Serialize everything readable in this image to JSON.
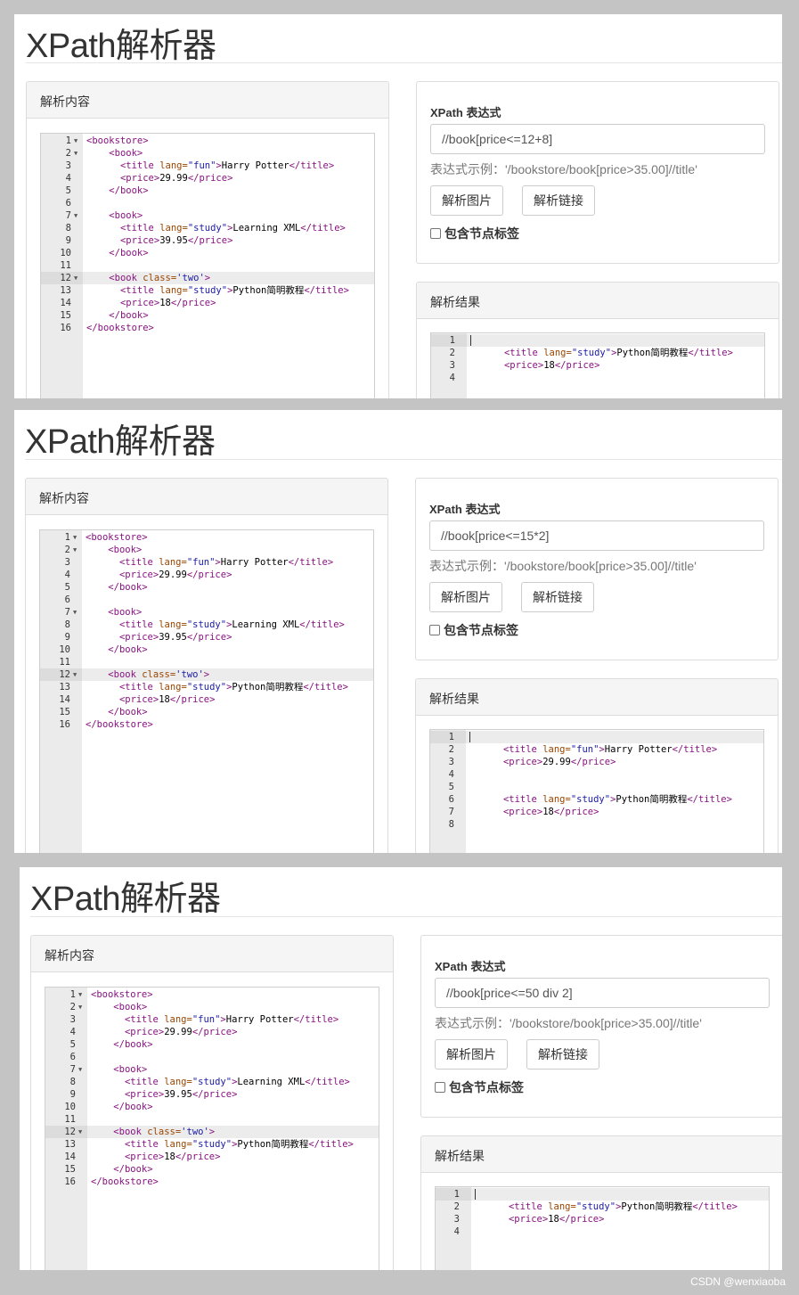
{
  "app_title": "XPath解析器",
  "content_panel_title": "解析内容",
  "xpath_label": "XPath 表达式",
  "example_label": "表达式示例：",
  "example_expr": "'/bookstore/book[price>35.00]//title'",
  "parse_image_button": "解析图片",
  "parse_link_button": "解析链接",
  "include_tags_label": "包含节点标签",
  "result_panel_title": "解析结果",
  "source_code": [
    [
      {
        "t": "tag",
        "s": "<bookstore>"
      }
    ],
    [
      {
        "t": "txt",
        "s": "    "
      },
      {
        "t": "tag",
        "s": "<book>"
      }
    ],
    [
      {
        "t": "txt",
        "s": "      "
      },
      {
        "t": "tag",
        "s": "<title "
      },
      {
        "t": "attr",
        "s": "lang="
      },
      {
        "t": "val",
        "s": "\"fun\""
      },
      {
        "t": "tag",
        "s": ">"
      },
      {
        "t": "txt",
        "s": "Harry Potter"
      },
      {
        "t": "tag",
        "s": "</title>"
      }
    ],
    [
      {
        "t": "txt",
        "s": "      "
      },
      {
        "t": "tag",
        "s": "<price>"
      },
      {
        "t": "txt",
        "s": "29.99"
      },
      {
        "t": "tag",
        "s": "</price>"
      }
    ],
    [
      {
        "t": "txt",
        "s": "    "
      },
      {
        "t": "tag",
        "s": "</book>"
      }
    ],
    [],
    [
      {
        "t": "txt",
        "s": "    "
      },
      {
        "t": "tag",
        "s": "<book>"
      }
    ],
    [
      {
        "t": "txt",
        "s": "      "
      },
      {
        "t": "tag",
        "s": "<title "
      },
      {
        "t": "attr",
        "s": "lang="
      },
      {
        "t": "val",
        "s": "\"study\""
      },
      {
        "t": "tag",
        "s": ">"
      },
      {
        "t": "txt",
        "s": "Learning XML"
      },
      {
        "t": "tag",
        "s": "</title>"
      }
    ],
    [
      {
        "t": "txt",
        "s": "      "
      },
      {
        "t": "tag",
        "s": "<price>"
      },
      {
        "t": "txt",
        "s": "39.95"
      },
      {
        "t": "tag",
        "s": "</price>"
      }
    ],
    [
      {
        "t": "txt",
        "s": "    "
      },
      {
        "t": "tag",
        "s": "</book>"
      }
    ],
    [],
    [
      {
        "t": "txt",
        "s": "    "
      },
      {
        "t": "tag",
        "s": "<book "
      },
      {
        "t": "attr",
        "s": "class="
      },
      {
        "t": "val",
        "s": "'two'"
      },
      {
        "t": "tag",
        "s": ">"
      }
    ],
    [
      {
        "t": "txt",
        "s": "      "
      },
      {
        "t": "tag",
        "s": "<title "
      },
      {
        "t": "attr",
        "s": "lang="
      },
      {
        "t": "val",
        "s": "\"study\""
      },
      {
        "t": "tag",
        "s": ">"
      },
      {
        "t": "txt",
        "s": "Python简明教程"
      },
      {
        "t": "tag",
        "s": "</title>"
      }
    ],
    [
      {
        "t": "txt",
        "s": "      "
      },
      {
        "t": "tag",
        "s": "<price>"
      },
      {
        "t": "txt",
        "s": "18"
      },
      {
        "t": "tag",
        "s": "</price>"
      }
    ],
    [
      {
        "t": "txt",
        "s": "    "
      },
      {
        "t": "tag",
        "s": "</book>"
      }
    ],
    [
      {
        "t": "tag",
        "s": "</bookstore>"
      }
    ]
  ],
  "fold_lines": [
    1,
    2,
    7,
    12
  ],
  "active_line": 12,
  "screens": [
    {
      "xpath": "//book[price<=12+8]",
      "result": [
        [],
        [
          {
            "t": "txt",
            "s": "      "
          },
          {
            "t": "tag",
            "s": "<title "
          },
          {
            "t": "attr",
            "s": "lang="
          },
          {
            "t": "val",
            "s": "\"study\""
          },
          {
            "t": "tag",
            "s": ">"
          },
          {
            "t": "txt",
            "s": "Python简明教程"
          },
          {
            "t": "tag",
            "s": "</title>"
          }
        ],
        [
          {
            "t": "txt",
            "s": "      "
          },
          {
            "t": "tag",
            "s": "<price>"
          },
          {
            "t": "txt",
            "s": "18"
          },
          {
            "t": "tag",
            "s": "</price>"
          }
        ],
        []
      ]
    },
    {
      "xpath": "//book[price<=15*2]",
      "result": [
        [],
        [
          {
            "t": "txt",
            "s": "      "
          },
          {
            "t": "tag",
            "s": "<title "
          },
          {
            "t": "attr",
            "s": "lang="
          },
          {
            "t": "val",
            "s": "\"fun\""
          },
          {
            "t": "tag",
            "s": ">"
          },
          {
            "t": "txt",
            "s": "Harry Potter"
          },
          {
            "t": "tag",
            "s": "</title>"
          }
        ],
        [
          {
            "t": "txt",
            "s": "      "
          },
          {
            "t": "tag",
            "s": "<price>"
          },
          {
            "t": "txt",
            "s": "29.99"
          },
          {
            "t": "tag",
            "s": "</price>"
          }
        ],
        [],
        [],
        [
          {
            "t": "txt",
            "s": "      "
          },
          {
            "t": "tag",
            "s": "<title "
          },
          {
            "t": "attr",
            "s": "lang="
          },
          {
            "t": "val",
            "s": "\"study\""
          },
          {
            "t": "tag",
            "s": ">"
          },
          {
            "t": "txt",
            "s": "Python简明教程"
          },
          {
            "t": "tag",
            "s": "</title>"
          }
        ],
        [
          {
            "t": "txt",
            "s": "      "
          },
          {
            "t": "tag",
            "s": "<price>"
          },
          {
            "t": "txt",
            "s": "18"
          },
          {
            "t": "tag",
            "s": "</price>"
          }
        ],
        []
      ]
    },
    {
      "xpath": "//book[price<=50 div 2]",
      "result": [
        [],
        [
          {
            "t": "txt",
            "s": "      "
          },
          {
            "t": "tag",
            "s": "<title "
          },
          {
            "t": "attr",
            "s": "lang="
          },
          {
            "t": "val",
            "s": "\"study\""
          },
          {
            "t": "tag",
            "s": ">"
          },
          {
            "t": "txt",
            "s": "Python简明教程"
          },
          {
            "t": "tag",
            "s": "</title>"
          }
        ],
        [
          {
            "t": "txt",
            "s": "      "
          },
          {
            "t": "tag",
            "s": "<price>"
          },
          {
            "t": "txt",
            "s": "18"
          },
          {
            "t": "tag",
            "s": "</price>"
          }
        ],
        []
      ]
    }
  ],
  "watermark": "CSDN @wenxiaoba"
}
